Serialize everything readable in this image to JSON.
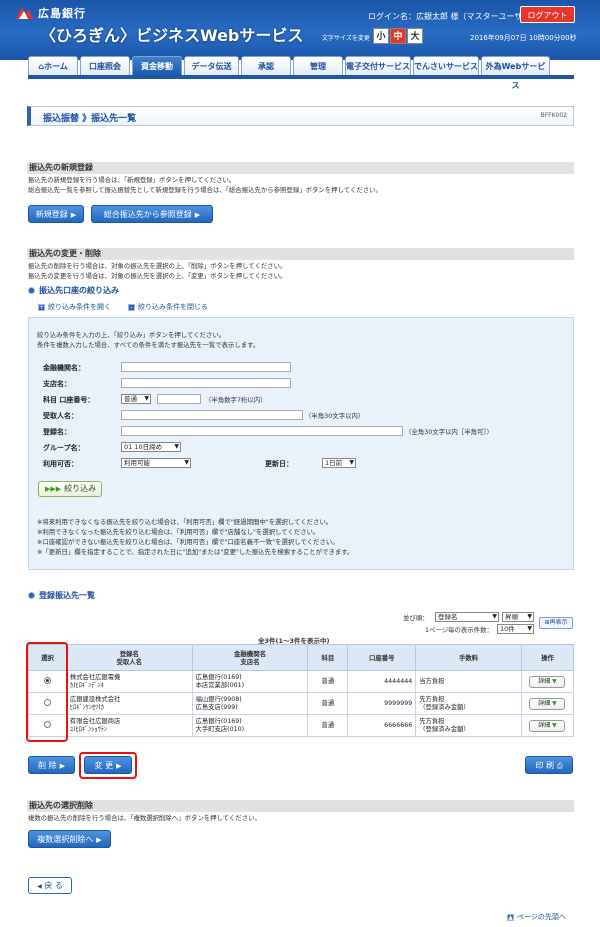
{
  "header": {
    "bank_name": "広島銀行",
    "service_name": "〈ひろぎん〉ビジネスWebサービス",
    "login_label": "ログイン名：",
    "login_user": "広銀太郎 様（マスターユーザ）",
    "logout": "ログアウト",
    "font_size_label": "文字サイズを変更",
    "font_small": "小",
    "font_medium": "中",
    "font_large": "大",
    "datetime": "2016年09月07日 10時00分00秒"
  },
  "nav": {
    "tabs": [
      {
        "label": "ホーム"
      },
      {
        "label": "口座照会"
      },
      {
        "label": "資金移動"
      },
      {
        "label": "データ伝送"
      },
      {
        "label": "承認"
      },
      {
        "label": "管理"
      },
      {
        "label": "電子交付サービス"
      },
      {
        "label": "でんさいサービス"
      },
      {
        "label": "外為Webサービス"
      }
    ]
  },
  "page": {
    "breadcrumb": "振込振替 》振込先一覧",
    "screen_id": "BFFK002"
  },
  "register": {
    "heading": "振込先の新規登録",
    "desc1": "振込先の新規登録を行う場合は、「新規登録」ボタンを押してください。",
    "desc2": "総合振込先一覧を参照して振込振替先として新規登録を行う場合は、「総合振込先から参照登録」ボタンを押してください。",
    "new_btn": "新規登録",
    "ref_btn": "総合振込先から参照登録"
  },
  "change": {
    "heading": "振込先の変更・削除",
    "desc1": "振込先の削除を行う場合は、対象の振込先を選択の上、「削除」ボタンを押してください。",
    "desc2": "振込先の変更を行う場合は、対象の振込先を選択の上、「変更」ボタンを押してください。"
  },
  "filter": {
    "title": "振込先口座の絞り込み",
    "open": "絞り込み条件を開く",
    "close": "絞り込み条件を閉じる",
    "intro1": "絞り込み条件を入力の上、「絞り込み」ボタンを押してください。",
    "intro2": "条件を複数入力した場合、すべての条件を満たす振込先を一覧で表示します。",
    "bank_label": "金融機関名：",
    "branch_label": "支店名：",
    "account_label": "科目 口座番号：",
    "account_type": "普通",
    "account_hint": "（半角数字7桁以内）",
    "payee_label": "受取人名：",
    "payee_hint": "（半角30文字以内）",
    "reg_label": "登録名：",
    "reg_hint": "（全角30文字以内［半角可］）",
    "group_label": "グループ名：",
    "group_value": "01 10日締め",
    "avail_label": "利用可否：",
    "avail_value": "利用可能",
    "updated_label": "更新日：",
    "updated_value": "1日前",
    "button": "絞り込み",
    "note1": "※将来利用できなくなる振込先を絞り込む場合は、「利用可否」欄で\"経過期間中\"を選択してください。",
    "note2": "※利用できなくなった振込先を絞り込む場合は、「利用可否」欄で\"店舗なし\"を選択してください。",
    "note3": "※口座確認ができない振込先を絞り込む場合は、「利用可否」欄で\"口座名義不一致\"を選択してください。",
    "note4": "※「更新日」欄を指定することで、指定された日に\"追加\"または\"変更\"した振込先を検索することができます。"
  },
  "list": {
    "title": "登録振込先一覧",
    "sort_label": "並び順：",
    "sort_field": "登録名",
    "sort_order": "昇順",
    "per_page_label": "1ページ毎の表示件数：",
    "per_page": "10件",
    "redisplay": "再表示",
    "count": "全3件(1〜3件を表示中)",
    "headers": {
      "select": "選択",
      "reg1": "登録名",
      "reg2": "受取人名",
      "bank1": "金融機関名",
      "bank2": "支店名",
      "subject": "科目",
      "account": "口座番号",
      "fee": "手数料",
      "op": "操作"
    },
    "detail_label": "詳細",
    "rows": [
      {
        "name1": "株式会社広銀電機",
        "name2": "ｶ)ﾋﾛｷﾞﾝﾃﾞﾝｷ",
        "bank1": "広島銀行(0169)",
        "bank2": "本店営業部(001)",
        "subject": "普通",
        "account": "4444444",
        "fee1": "当方負担",
        "fee2": ""
      },
      {
        "name1": "広銀建設株式会社",
        "name2": "ﾋﾛｷﾞﾝｹﾝｾﾂ(ｶ",
        "bank1": "福山銀行(9908)",
        "bank2": "広島支店(999)",
        "subject": "普通",
        "account": "9999999",
        "fee1": "先方負担",
        "fee2": "（登録済み金額）"
      },
      {
        "name1": "有限会社広銀商店",
        "name2": "ﾕ)ﾋﾛｷﾞﾝｼｮｳﾃﾝ",
        "bank1": "広島銀行(0169)",
        "bank2": "大手町支店(010)",
        "subject": "普通",
        "account": "6666666",
        "fee1": "先方負担",
        "fee2": "（登録済み金額）"
      }
    ],
    "delete_btn": "削 除",
    "change_btn": "変 更",
    "print_btn": "印 刷"
  },
  "multi": {
    "heading": "振込先の選択削除",
    "desc": "複数の振込先の削除を行う場合は、「複数選択削除へ」ボタンを押してください。",
    "button": "複数選択削除へ"
  },
  "footer": {
    "back": "戻 る",
    "page_top": "ページの先頭へ"
  }
}
